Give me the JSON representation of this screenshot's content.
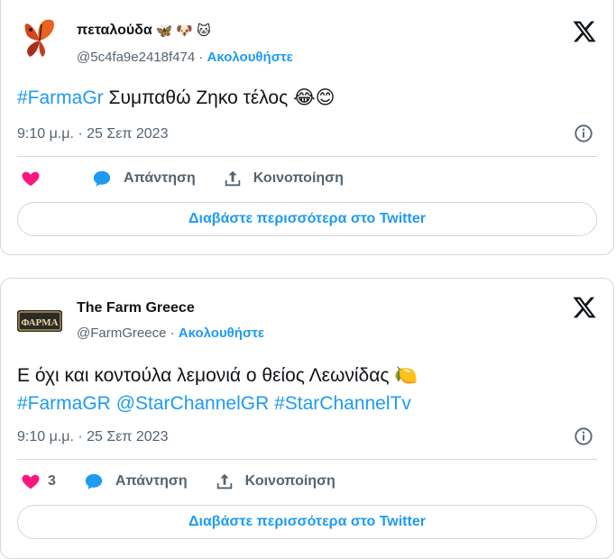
{
  "tweets": [
    {
      "author_name": "πεταλούδα",
      "author_emojis": [
        "🦋",
        "🐶",
        "🐱"
      ],
      "handle": "@5c4fa9e2418f474",
      "follow_label": "Ακολουθήστε",
      "text_hashtag": "#FarmaGr",
      "text_body": " Συμπαθώ Ζηκο τέλος ",
      "text_emojis": "😂😊",
      "timestamp": "9:10 μ.μ. · 25 Σεπ 2023",
      "like_count": "",
      "reply_label": "Απάντηση",
      "share_label": "Κοινοποίηση",
      "read_more_label": "Διαβάστε περισσότερα στο Twitter"
    },
    {
      "author_name": "The Farm Greece",
      "avatar_text": "ΦΑΡΜΑ",
      "handle": "@FarmGreece",
      "follow_label": "Ακολουθήστε",
      "text_line1": "Ε όχι και κοντούλα λεμονιά ο θείος Λεωνίδας ",
      "text_line1_emoji": "🍋",
      "hashtags": [
        "#FarmaGR",
        "@StarChannelGR",
        "#StarChannelTv"
      ],
      "timestamp": "9:10 μ.μ. · 25 Σεπ 2023",
      "like_count": "3",
      "reply_label": "Απάντηση",
      "share_label": "Κοινοποίηση",
      "read_more_label": "Διαβάστε περισσότερα στο Twitter"
    }
  ],
  "colors": {
    "accent": "#1d9bf0",
    "like": "#f91880",
    "muted": "#536471",
    "border": "#cfd9de"
  }
}
